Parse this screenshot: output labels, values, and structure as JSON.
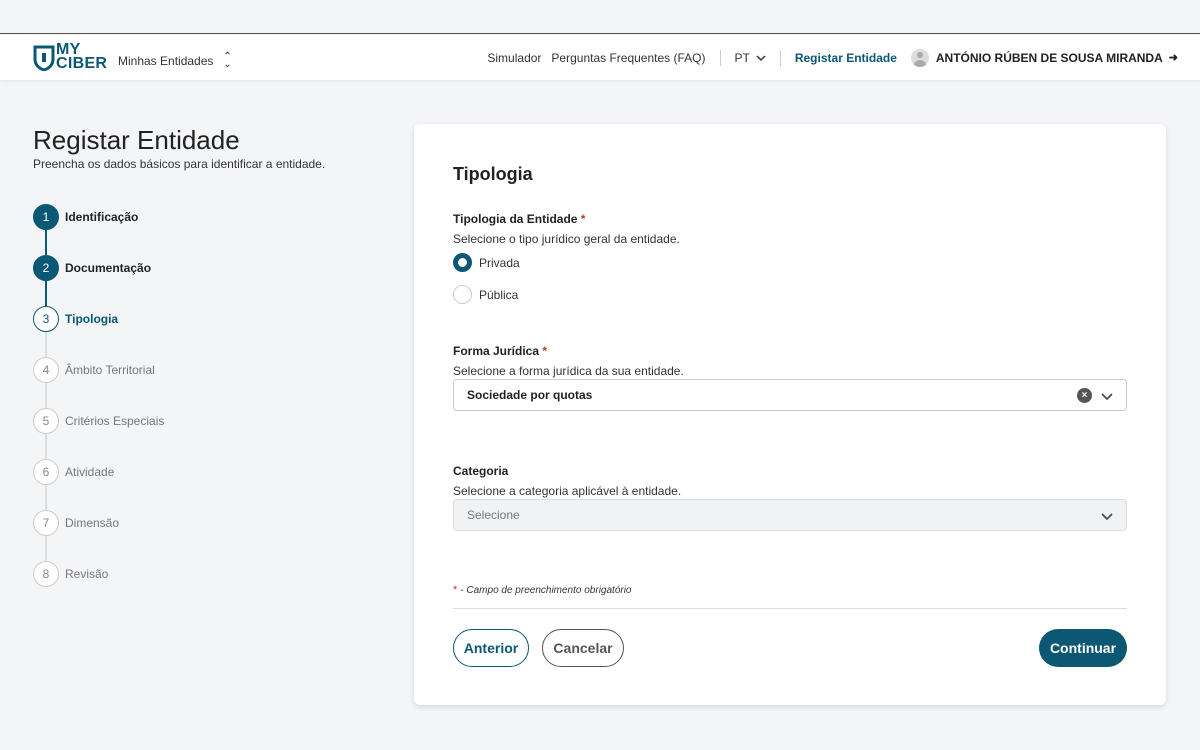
{
  "header": {
    "logo_line1": "MY",
    "logo_line2": "CIBER",
    "entities_label": "Minhas Entidades",
    "nav": {
      "simulator": "Simulador",
      "faq": "Perguntas Frequentes (FAQ)",
      "lang": "PT",
      "register": "Registar Entidade",
      "user": "ANTÓNIO RÚBEN DE SOUSA MIRANDA"
    }
  },
  "page": {
    "title": "Registar Entidade",
    "subtitle": "Preencha os dados básicos para identificar a entidade."
  },
  "steps": [
    {
      "num": "1",
      "label": "Identificação",
      "state": "done"
    },
    {
      "num": "2",
      "label": "Documentação",
      "state": "done"
    },
    {
      "num": "3",
      "label": "Tipologia",
      "state": "active"
    },
    {
      "num": "4",
      "label": "Âmbito Territorial",
      "state": "pending"
    },
    {
      "num": "5",
      "label": "Critérios Especiais",
      "state": "pending"
    },
    {
      "num": "6",
      "label": "Atividade",
      "state": "pending"
    },
    {
      "num": "7",
      "label": "Dimensão",
      "state": "pending"
    },
    {
      "num": "8",
      "label": "Revisão",
      "state": "pending"
    }
  ],
  "form": {
    "section_title": "Tipologia",
    "tipologia": {
      "label": "Tipologia da Entidade",
      "required_mark": "*",
      "help": "Selecione o tipo jurídico geral da entidade.",
      "options": [
        {
          "label": "Privada",
          "selected": true
        },
        {
          "label": "Pública",
          "selected": false
        }
      ]
    },
    "forma": {
      "label": "Forma Jurídica",
      "required_mark": "*",
      "help": "Selecione a forma jurídica da sua entidade.",
      "value": "Sociedade por quotas"
    },
    "categoria": {
      "label": "Categoria",
      "help": "Selecione a categoria aplicável à entidade.",
      "placeholder": "Selecione"
    },
    "required_note_mark": "*",
    "required_note": "- Campo de preenchimento obrigatório",
    "buttons": {
      "prev": "Anterior",
      "cancel": "Cancelar",
      "next": "Continuar"
    }
  },
  "colors": {
    "primary": "#0b5874",
    "required": "#c0392b"
  }
}
